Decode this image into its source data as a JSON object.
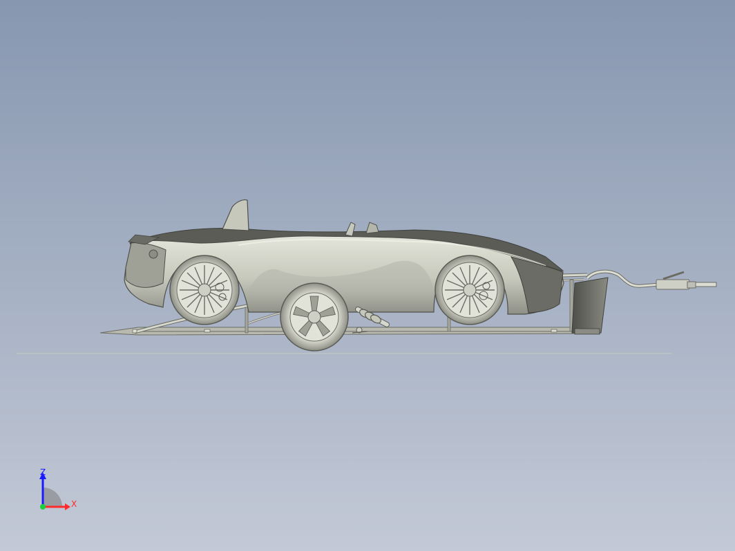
{
  "viewport": {
    "background_top": "#8797b0",
    "background_bottom": "#c3c9d6",
    "model_color": "#c8c9bd",
    "model_shadow": "#5e5f58",
    "model_outline": "#4e4f4a"
  },
  "triad": {
    "z_label": "Z",
    "x_label": "X",
    "z_color": "#1a1aff",
    "x_color": "#ff2a2a",
    "y_color": "#1ccf3c"
  }
}
